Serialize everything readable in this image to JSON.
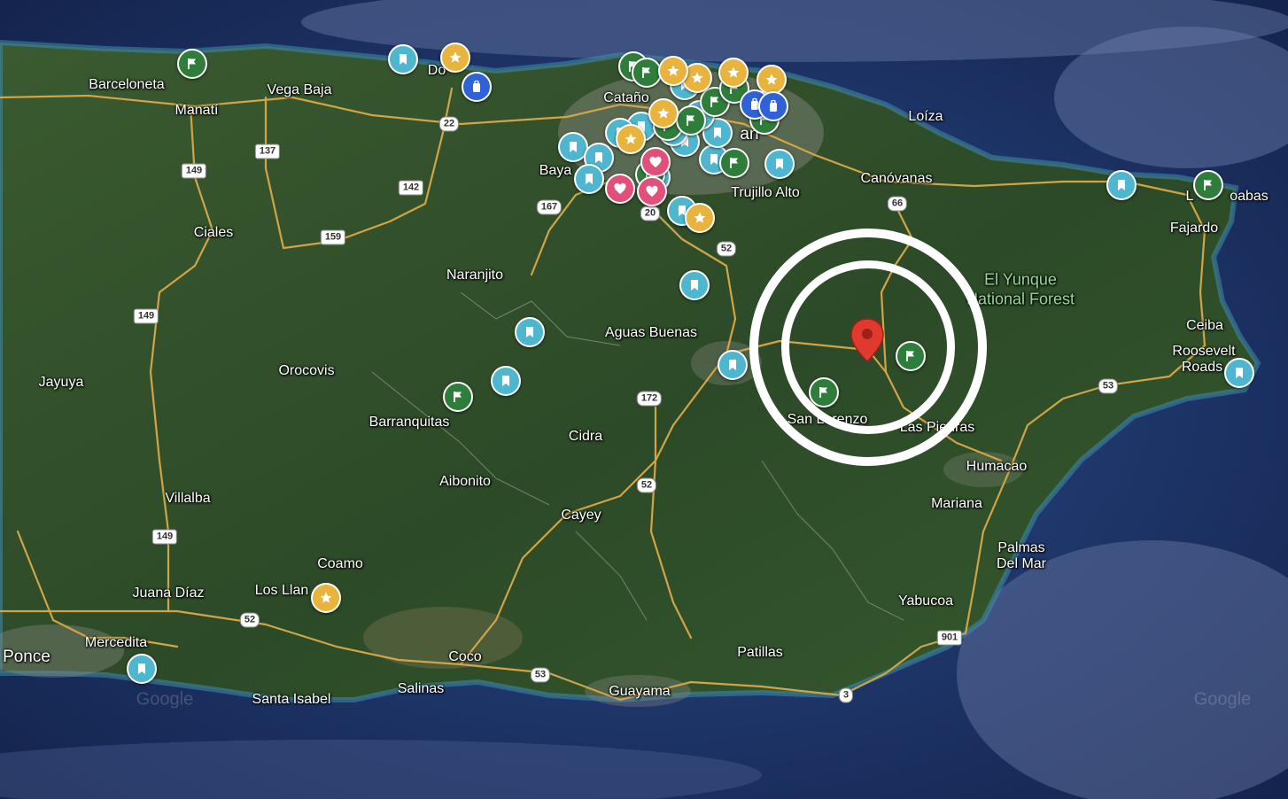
{
  "colors": {
    "ocean": "#1d3366",
    "land": "#2f4d2a",
    "road": "#d1a447",
    "pin_bookmark": "#4fb6cf",
    "pin_flag": "#2f7d3a",
    "pin_star": "#e9b43e",
    "pin_heart": "#e0507a",
    "pin_luggage": "#2f62d7",
    "marker": "#e03a2f",
    "rings": "#ffffff"
  },
  "labels": [
    {
      "name": "Barceloneta",
      "text": "Barceloneta"
    },
    {
      "name": "Manati",
      "text": "Manatí"
    },
    {
      "name": "Vega-Baja",
      "text": "Vega Baja"
    },
    {
      "name": "Dorado",
      "text": "Do"
    },
    {
      "name": "Catano",
      "text": "Cataño"
    },
    {
      "name": "San-Juan",
      "text": "an"
    },
    {
      "name": "Bayamon",
      "text": "Baya"
    },
    {
      "name": "Trujillo-Alto",
      "text": "Trujillo Alto"
    },
    {
      "name": "Loiza",
      "text": "Loíza"
    },
    {
      "name": "Canovanas",
      "text": "Canóvanas"
    },
    {
      "name": "Luquillo",
      "text": "L"
    },
    {
      "name": "Loquillo-2",
      "text": "oabas"
    },
    {
      "name": "Fajardo",
      "text": "Fajardo"
    },
    {
      "name": "Ciales",
      "text": "Ciales"
    },
    {
      "name": "Naranjito",
      "text": "Naranjito"
    },
    {
      "name": "Aguas-Buenas",
      "text": "Aguas Buenas"
    },
    {
      "name": "Ceiba",
      "text": "Ceiba"
    },
    {
      "name": "Roosevelt",
      "text": "Roosevelt"
    },
    {
      "name": "Roads",
      "text": "Roads"
    },
    {
      "name": "Jayuya",
      "text": "Jayuya"
    },
    {
      "name": "Orocovis",
      "text": "Orocovis"
    },
    {
      "name": "Barranquitas",
      "text": "Barranquitas"
    },
    {
      "name": "Cidra",
      "text": "Cidra"
    },
    {
      "name": "San-Lorenzo",
      "text": "San Lorenzo"
    },
    {
      "name": "Las-Piedras",
      "text": "Las Piedras"
    },
    {
      "name": "Humacao",
      "text": "Humacao"
    },
    {
      "name": "Aibonito",
      "text": "Aibonito"
    },
    {
      "name": "Villalba",
      "text": "Villalba"
    },
    {
      "name": "Cayey",
      "text": "Cayey"
    },
    {
      "name": "Mariana",
      "text": "Mariana"
    },
    {
      "name": "Palmas",
      "text": "Palmas"
    },
    {
      "name": "Del-Mar",
      "text": "Del Mar"
    },
    {
      "name": "Coamo",
      "text": "Coamo"
    },
    {
      "name": "Los-Llanos",
      "text": "Los Llan"
    },
    {
      "name": "Juana-Diaz",
      "text": "Juana Díaz"
    },
    {
      "name": "Mercedita",
      "text": "Mercedita"
    },
    {
      "name": "Ponce",
      "text": "Ponce"
    },
    {
      "name": "Yabucoa",
      "text": "Yabucoa"
    },
    {
      "name": "Coco",
      "text": "Coco"
    },
    {
      "name": "Patillas",
      "text": "Patillas"
    },
    {
      "name": "Salinas",
      "text": "Salinas"
    },
    {
      "name": "Santa-Isabel",
      "text": "Santa Isabel"
    },
    {
      "name": "Guayama",
      "text": "Guayama"
    }
  ],
  "park_label": {
    "line1": "El Yunque",
    "line2": "National Forest"
  },
  "route_shields": [
    "22",
    "137",
    "149",
    "142",
    "167",
    "20",
    "159",
    "52",
    "66",
    "149",
    "172",
    "52",
    "53",
    "149",
    "52",
    "53",
    "3",
    "901"
  ],
  "watermarks": [
    "Google",
    "Google"
  ],
  "pins": {
    "bookmark": 22,
    "flag": 14,
    "star": 9,
    "heart": 3,
    "luggage": 3
  }
}
